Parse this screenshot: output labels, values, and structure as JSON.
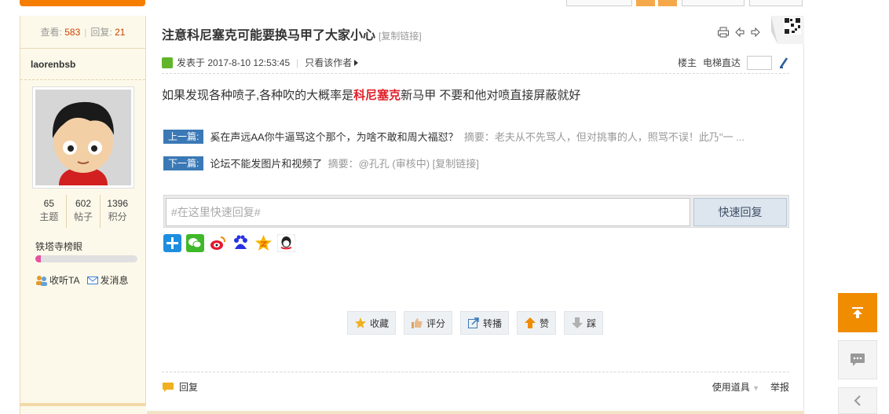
{
  "stats": {
    "views_label": "查看:",
    "views": "583",
    "replies_label": "回复:",
    "replies": "21"
  },
  "author": {
    "name": "laorenbsb",
    "topics": "65",
    "topics_label": "主题",
    "posts": "602",
    "posts_label": "帖子",
    "credits": "1396",
    "credits_label": "积分",
    "rank": "铁塔寺榜眼",
    "rank_progress": 0.05,
    "follow_label": "收听TA",
    "message_label": "发消息"
  },
  "post": {
    "title": "注意科尼塞克可能要换马甲了大家小心",
    "copy_link": "[复制链接]",
    "posted_prefix": "发表于",
    "posted_at": "2017-8-10 12:53:45",
    "author_only": "只看该作者",
    "floor_label": "楼主",
    "elevator_label": "电梯直达",
    "content_before": "如果发现各种喷子,各种吹的大概率是",
    "content_highlight": "科尼塞克",
    "content_after": "新马甲 不要和他对喷直接屏蔽就好"
  },
  "navigation": {
    "prev_tag": "上一篇:",
    "prev_title": "奚在声远AA你牛逼骂这个那个，为啥不敢和周大福怼？",
    "prev_summary": "摘要：老夫从不先骂人，但对挑事的人，照骂不误！此乃\"一 ...",
    "next_tag": "下一篇:",
    "next_title": "论坛不能发图片和视频了",
    "next_summary": "摘要：@孔孔 (审核中) [复制链接]"
  },
  "quick_reply": {
    "placeholder": "#在这里快速回复#",
    "button": "快速回复"
  },
  "actions": {
    "favorite": "收藏",
    "rate": "评分",
    "forward": "转播",
    "like": "赞",
    "dislike": "踩"
  },
  "footer": {
    "reply": "回复",
    "tools": "使用道具",
    "report": "举报"
  },
  "colors": {
    "accent": "#f08c00",
    "highlight": "#e0202a",
    "nav_tag": "#3b79b6",
    "sidebar_bg": "#fdf9ea"
  },
  "icons": [
    "print-icon",
    "prev-arrow-icon",
    "next-arrow-icon",
    "qr-code-icon",
    "back-to-top-icon",
    "chat-icon",
    "chevron-left-icon"
  ]
}
